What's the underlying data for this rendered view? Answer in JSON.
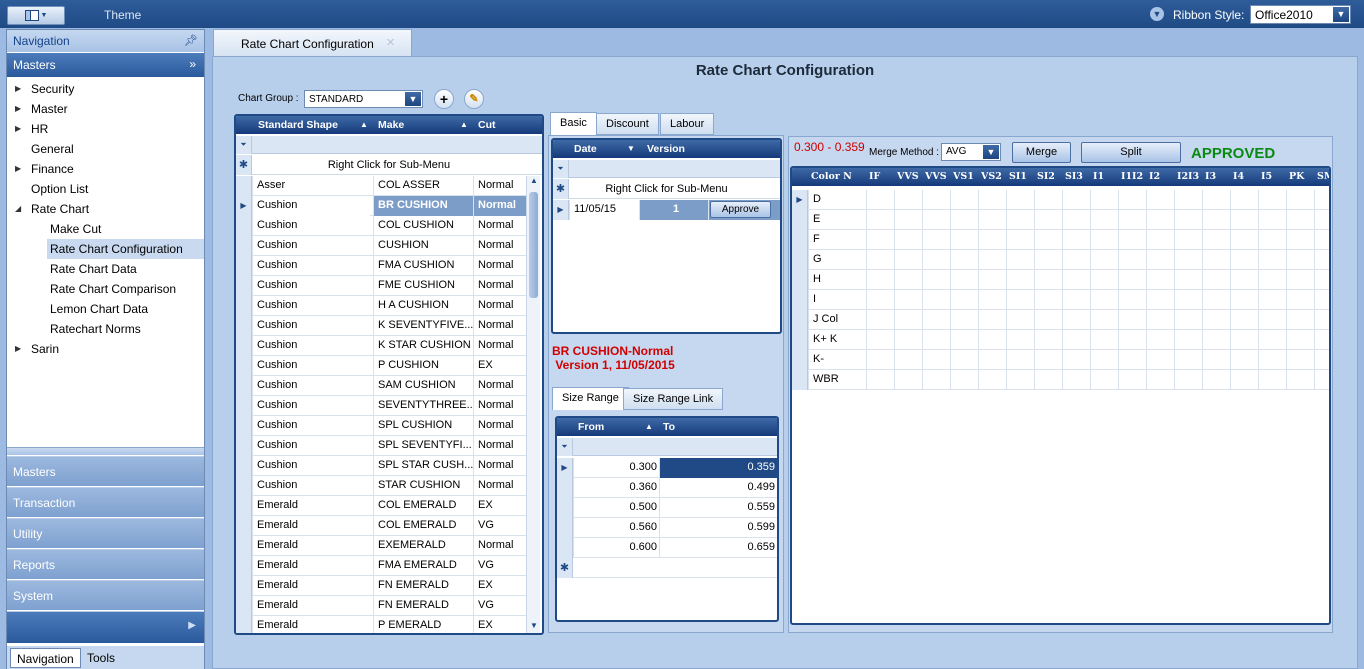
{
  "ribbon": {
    "theme_label": "Theme",
    "style_label": "Ribbon Style:",
    "style_value": "Office2010"
  },
  "nav": {
    "header": "Navigation",
    "group": "Masters",
    "items": [
      {
        "label": "Security",
        "level": 0,
        "arrow": "right"
      },
      {
        "label": "Master",
        "level": 0,
        "arrow": "right"
      },
      {
        "label": "HR",
        "level": 0,
        "arrow": "right"
      },
      {
        "label": "General",
        "level": 0,
        "arrow": ""
      },
      {
        "label": "Finance",
        "level": 0,
        "arrow": "right"
      },
      {
        "label": "Option List",
        "level": 0,
        "arrow": ""
      },
      {
        "label": "Rate Chart",
        "level": 0,
        "arrow": "down"
      },
      {
        "label": "Make Cut",
        "level": 1,
        "arrow": ""
      },
      {
        "label": "Rate Chart Configuration",
        "level": 1,
        "arrow": "",
        "selected": true
      },
      {
        "label": "Rate Chart Data",
        "level": 1,
        "arrow": ""
      },
      {
        "label": "Rate Chart Comparison",
        "level": 1,
        "arrow": ""
      },
      {
        "label": "Lemon Chart Data",
        "level": 1,
        "arrow": ""
      },
      {
        "label": "Ratechart Norms",
        "level": 1,
        "arrow": ""
      },
      {
        "label": "Sarin",
        "level": 0,
        "arrow": "right"
      }
    ],
    "buttons": [
      "Masters",
      "Transaction",
      "Utility",
      "Reports",
      "System"
    ],
    "tabs": [
      "Navigation",
      "Tools"
    ]
  },
  "doc": {
    "tab_label": "Rate Chart Configuration",
    "title": "Rate Chart Configuration"
  },
  "chart_group": {
    "label": "Chart Group :",
    "value": "STANDARD"
  },
  "shape_grid": {
    "headers": [
      "Standard Shape",
      "Make",
      "Cut"
    ],
    "new_row_text": "Right Click for Sub-Menu",
    "selected_index": 1,
    "rows": [
      [
        "Asser",
        "COL ASSER",
        "Normal"
      ],
      [
        "Cushion",
        "BR CUSHION",
        "Normal"
      ],
      [
        "Cushion",
        "COL CUSHION",
        "Normal"
      ],
      [
        "Cushion",
        "CUSHION",
        "Normal"
      ],
      [
        "Cushion",
        "FMA CUSHION",
        "Normal"
      ],
      [
        "Cushion",
        "FME CUSHION",
        "Normal"
      ],
      [
        "Cushion",
        "H A CUSHION",
        "Normal"
      ],
      [
        "Cushion",
        "K SEVENTYFIVE...",
        "Normal"
      ],
      [
        "Cushion",
        "K STAR CUSHION",
        "Normal"
      ],
      [
        "Cushion",
        "P CUSHION",
        "EX"
      ],
      [
        "Cushion",
        "SAM CUSHION",
        "Normal"
      ],
      [
        "Cushion",
        "SEVENTYTHREE...",
        "Normal"
      ],
      [
        "Cushion",
        "SPL CUSHION",
        "Normal"
      ],
      [
        "Cushion",
        "SPL SEVENTYFI...",
        "Normal"
      ],
      [
        "Cushion",
        "SPL STAR CUSH...",
        "Normal"
      ],
      [
        "Cushion",
        "STAR CUSHION",
        "Normal"
      ],
      [
        "Emerald",
        "COL EMERALD",
        "EX"
      ],
      [
        "Emerald",
        "COL EMERALD",
        "VG"
      ],
      [
        "Emerald",
        "EXEMERALD",
        "Normal"
      ],
      [
        "Emerald",
        "FMA EMERALD",
        "VG"
      ],
      [
        "Emerald",
        "FN EMERALD",
        "EX"
      ],
      [
        "Emerald",
        "FN EMERALD",
        "VG"
      ],
      [
        "Emerald",
        "P EMERALD",
        "EX"
      ]
    ]
  },
  "tabs": [
    "Basic",
    "Discount",
    "Labour"
  ],
  "version_grid": {
    "headers": [
      "Date",
      "Version"
    ],
    "new_row_text": "Right Click for Sub-Menu",
    "rows": [
      {
        "date": "11/05/15",
        "version": "1",
        "action": "Approve"
      }
    ]
  },
  "selected_info": {
    "line1": "BR CUSHION-Normal",
    "line2": " Version 1, 11/05/2015"
  },
  "size_tabs": [
    "Size Range",
    "Size Range Link"
  ],
  "size_grid": {
    "headers": [
      "From",
      "To"
    ],
    "rows": [
      [
        "0.300",
        "0.359"
      ],
      [
        "0.360",
        "0.499"
      ],
      [
        "0.500",
        "0.559"
      ],
      [
        "0.560",
        "0.599"
      ],
      [
        "0.600",
        "0.659"
      ]
    ]
  },
  "rate": {
    "range": "0.300 - 0.359",
    "merge_label": "Merge Method :",
    "merge_value": "AVG",
    "merge_btn": "Merge",
    "split_btn": "Split",
    "status": "APPROVED",
    "status_color": "#0b8a12",
    "range_color": "#d00000"
  },
  "color_grid": {
    "headers": [
      "Color N",
      "IF",
      "VVS",
      "VVS",
      "VS1",
      "VS2",
      "SI1",
      "SI2",
      "SI3",
      "I1",
      "I1I2",
      "I2",
      "I2I3",
      "I3",
      "I4",
      "I5",
      "PK",
      "SMC"
    ],
    "rows": [
      "D",
      "E",
      "F",
      "G",
      "H",
      "I",
      "J Col",
      "K+ K",
      "K-",
      "WBR"
    ]
  }
}
